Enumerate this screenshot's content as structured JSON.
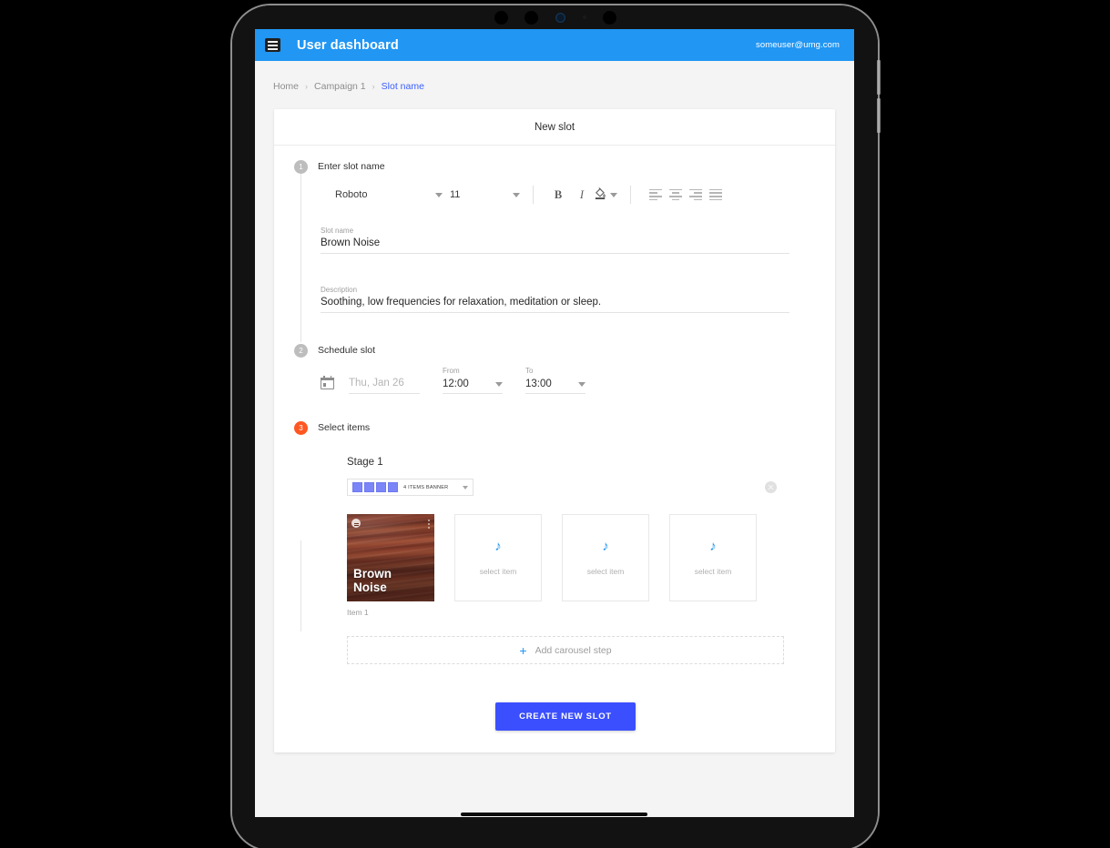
{
  "appbar": {
    "menu_icon": "hamburger-menu-icon",
    "title": "User dashboard",
    "user": "someuser@umg.com"
  },
  "breadcrumb": {
    "items": [
      {
        "label": "Home",
        "active": false
      },
      {
        "label": "Campaign 1",
        "active": false
      },
      {
        "label": "Slot name",
        "active": true
      }
    ],
    "separator": "›"
  },
  "card": {
    "title": "New slot"
  },
  "steps": [
    {
      "number": "1",
      "label": "Enter slot name",
      "active": false
    },
    {
      "number": "2",
      "label": "Schedule slot",
      "active": false
    },
    {
      "number": "3",
      "label": "Select items",
      "active": true
    }
  ],
  "editor_toolbar": {
    "font_family": "Roboto",
    "font_size": "11",
    "bold_label": "B",
    "italic_label": "I",
    "fill_icon": "fill-color-icon",
    "align_left_icon": "align-left-icon",
    "align_center_icon": "align-center-icon",
    "align_right_icon": "align-right-icon",
    "align_justify_icon": "align-justify-icon"
  },
  "form": {
    "slot_name_label": "Slot name",
    "slot_name_value": "Brown Noise",
    "description_label": "Description",
    "description_value": "Soothing, low frequencies for relaxation, meditation or sleep."
  },
  "schedule": {
    "calendar_icon": "calendar-icon",
    "date_placeholder": "Thu, Jan 26",
    "from_label": "From",
    "from_value": "12:00",
    "to_label": "To",
    "to_value": "13:00"
  },
  "stage": {
    "title": "Stage 1",
    "banner_select_value": "4 ITEMS BANNER",
    "banner_square_count": 4,
    "close_icon": "close-circle-icon",
    "items": [
      {
        "type": "filled",
        "art_title_line1": "Brown",
        "art_title_line2": "Noise",
        "caption": "Item 1",
        "badge_icon": "more-badge-icon",
        "dots_icon": "more-vert-icon"
      },
      {
        "type": "empty",
        "icon": "music-note-icon",
        "label": "select item",
        "caption": ""
      },
      {
        "type": "empty",
        "icon": "music-note-icon",
        "label": "select item",
        "caption": ""
      },
      {
        "type": "empty",
        "icon": "music-note-icon",
        "label": "select item",
        "caption": ""
      }
    ],
    "add_step_icon": "plus-icon",
    "add_step_label": "Add carousel step"
  },
  "footer": {
    "create_button": "CREATE NEW SLOT"
  },
  "colors": {
    "appbar_blue": "#2196f3",
    "accent_blue": "#3b4ffe",
    "step_active_orange": "#ff5722",
    "banner_square": "#7b85f7"
  },
  "music_note_glyph": "♪"
}
